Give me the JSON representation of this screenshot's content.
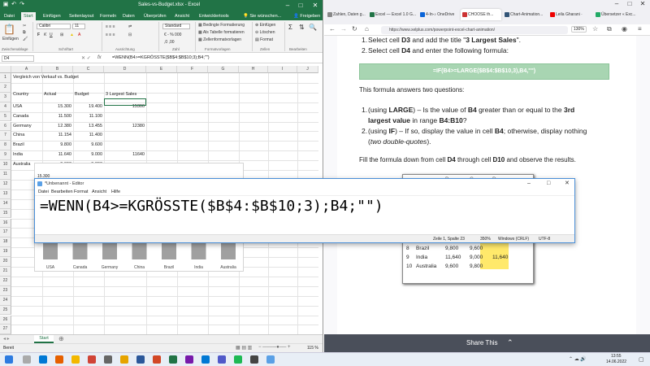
{
  "excel": {
    "title": "Sales-vs-Budget.xlsx - Excel",
    "tell_me": "Sie wünschen...",
    "share": "Freigeben",
    "tabs": [
      "Datei",
      "Start",
      "Einfügen",
      "Seitenlayout",
      "Formeln",
      "Daten",
      "Überprüfen",
      "Ansicht",
      "Entwicklertools"
    ],
    "ribbon": {
      "paste": "Einfügen",
      "font": "Calibri",
      "size": "11",
      "format": "Standard",
      "cond": "Bedingte Formatierung",
      "astable": "Als Tabelle formatieren",
      "cellstyles": "Zellenformatvorlagen",
      "insert": "Einfügen",
      "delete": "Löschen",
      "formatc": "Format",
      "groups": [
        "Zwischenablage",
        "Schriftart",
        "Ausrichtung",
        "Zahl",
        "Formatvorlagen",
        "Zellen",
        "Bearbeiten"
      ]
    },
    "namebox": "D4",
    "formula": "=WENN(B4>=KGRÖSSTE($B$4:$B$10;3);B4;\"\")",
    "columns": [
      "A",
      "B",
      "C",
      "D",
      "E",
      "F",
      "G",
      "H",
      "I",
      "J"
    ],
    "rows": [
      "1",
      "2",
      "3",
      "4",
      "5",
      "6",
      "7",
      "8",
      "9",
      "10",
      "11",
      "12",
      "13",
      "14",
      "15",
      "16",
      "17",
      "18",
      "19",
      "20",
      "21",
      "22",
      "23",
      "24",
      "25",
      "26",
      "27"
    ],
    "title_cell": "Vergleich von Verkauf vs. Budget",
    "headers": [
      "Country",
      "Actual",
      "Budget",
      "3 Largest Sales"
    ],
    "data": [
      [
        "USA",
        "15.300",
        "19.400",
        "15300"
      ],
      [
        "Canada",
        "11.500",
        "11.100",
        ""
      ],
      [
        "Germany",
        "12.380",
        "13.455",
        "12380"
      ],
      [
        "China",
        "11.154",
        "11.400",
        ""
      ],
      [
        "Brazil",
        "9.800",
        "9.600",
        ""
      ],
      [
        "India",
        "11.640",
        "9.000",
        "11640"
      ],
      [
        "Australia",
        "9.600",
        "9.800",
        ""
      ]
    ],
    "sheet": "Start",
    "status_left": "Bereit",
    "zoom": "115 %"
  },
  "chart": {
    "label_top": "15.300",
    "cats": [
      "USA",
      "Canada",
      "Germany",
      "China",
      "Brazil",
      "India",
      "Australia"
    ]
  },
  "firefox": {
    "tabs": [
      "Zahlen, Daten g...",
      "Excel — Excel 1.0 G...",
      "4-In-♪ OneDrive",
      "CHOOSE th...",
      "Chart-Animation...",
      "Leila Gharani ·",
      "Übersetzer « Exc..."
    ],
    "url": "https://www.xelplus.com/powerpoint-excel-chart-animation/",
    "zoom": "130%",
    "li1_a": "Select cell ",
    "li1_b": "D3",
    "li1_c": " and add the title \"",
    "li1_d": "3 Largest Sales",
    "li1_e": "\".",
    "li2_a": "Select cell ",
    "li2_b": "D4",
    "li2_c": " and enter the following formula:",
    "greenbar": "=IF(B4>=LARGE($B$4:$B$10,3),B4,\"\")",
    "p1": "This formula answers two questions:",
    "q1_a": "(using ",
    "q1_b": "LARGE",
    "q1_c": ") – Is the value of ",
    "q1_d": "B4",
    "q1_e": " greater than or equal to the ",
    "q1_f": "3rd",
    "q1_g": "largest value",
    "q1_h": " in range ",
    "q1_i": "B4:B10",
    "q1_j": "?",
    "q2_a": "(using ",
    "q2_b": "IF",
    "q2_c": ") – If so, display the value in cell ",
    "q2_d": "B4",
    "q2_e": "; otherwise, display nothing",
    "q2_f": "(",
    "q2_g": "two double-quotes",
    "q2_h": ").",
    "p2_a": "Fill the formula down from cell ",
    "p2_b": "D4",
    "p2_c": " through cell ",
    "p2_d": "D10",
    "p2_e": " and observe the results.",
    "table_cols": [
      "B",
      "C",
      "D"
    ],
    "table_rows": [
      [
        "7",
        "China",
        "11,154",
        "11,400",
        ""
      ],
      [
        "8",
        "Brazil",
        "9,800",
        "9,600",
        ""
      ],
      [
        "9",
        "India",
        "11,640",
        "9,000",
        "11,640"
      ],
      [
        "10",
        "Australia",
        "9,600",
        "9,800",
        ""
      ]
    ],
    "share": "Share This"
  },
  "notepad": {
    "title": "*Unbenannt - Editor",
    "menu": [
      "Datei",
      "Bearbeiten",
      "Format",
      "Ansicht",
      "Hilfe"
    ],
    "text": "=WENN(B4>=KGRÖSSTE($B$4:$B$10;3);B4;\"\")",
    "pos": "Zeile 1, Spalte 23",
    "zoom": "350%",
    "eol": "Windows (CRLF)",
    "enc": "UTF-8"
  },
  "taskbar": {
    "time": "13:55",
    "date": "14.06.2022"
  }
}
